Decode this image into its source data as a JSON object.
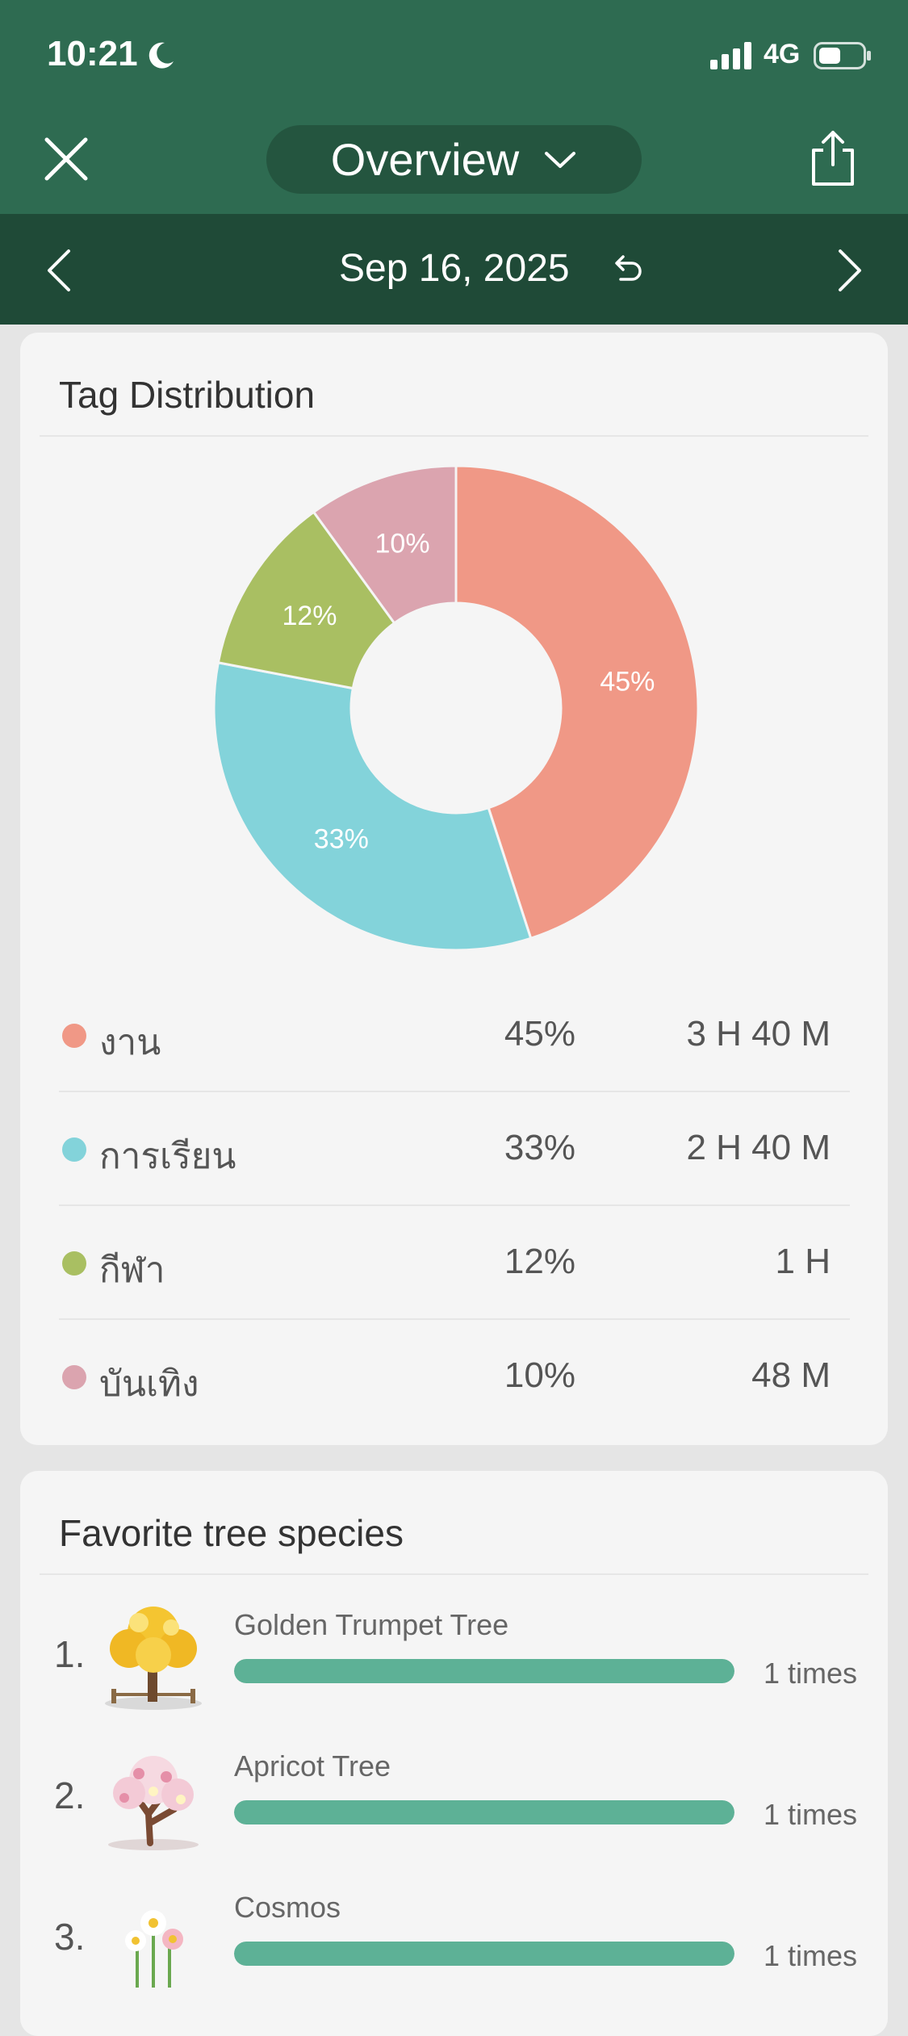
{
  "status": {
    "time": "10:21",
    "network": "4G"
  },
  "header": {
    "title": "Overview",
    "date": "Sep 16, 2025"
  },
  "tag_card": {
    "title": "Tag Distribution",
    "slices": [
      {
        "name": "งาน",
        "percent": 45,
        "label": "45%",
        "duration": "3 H 40 M",
        "color": "#f09886"
      },
      {
        "name": "การเรียน",
        "percent": 33,
        "label": "33%",
        "duration": "2 H 40 M",
        "color": "#83d3da"
      },
      {
        "name": "กีฬา",
        "percent": 12,
        "label": "12%",
        "duration": "1 H",
        "color": "#a9bf62"
      },
      {
        "name": "บันเทิง",
        "percent": 10,
        "label": "10%",
        "duration": "48 M",
        "color": "#dba4af"
      }
    ]
  },
  "species_card": {
    "title": "Favorite tree species",
    "items": [
      {
        "rank": "1.",
        "name": "Golden Trumpet Tree",
        "count": "1 times",
        "fill": 1.0,
        "icon": "golden-trumpet-tree-icon"
      },
      {
        "rank": "2.",
        "name": "Apricot Tree",
        "count": "1 times",
        "fill": 1.0,
        "icon": "apricot-tree-icon"
      },
      {
        "rank": "3.",
        "name": "Cosmos",
        "count": "1 times",
        "fill": 1.0,
        "icon": "cosmos-icon"
      }
    ],
    "bar_color": "#5db196"
  },
  "colors": {
    "header": "#2e6b51",
    "datebar": "#1f4a37",
    "pill": "#24553f"
  }
}
